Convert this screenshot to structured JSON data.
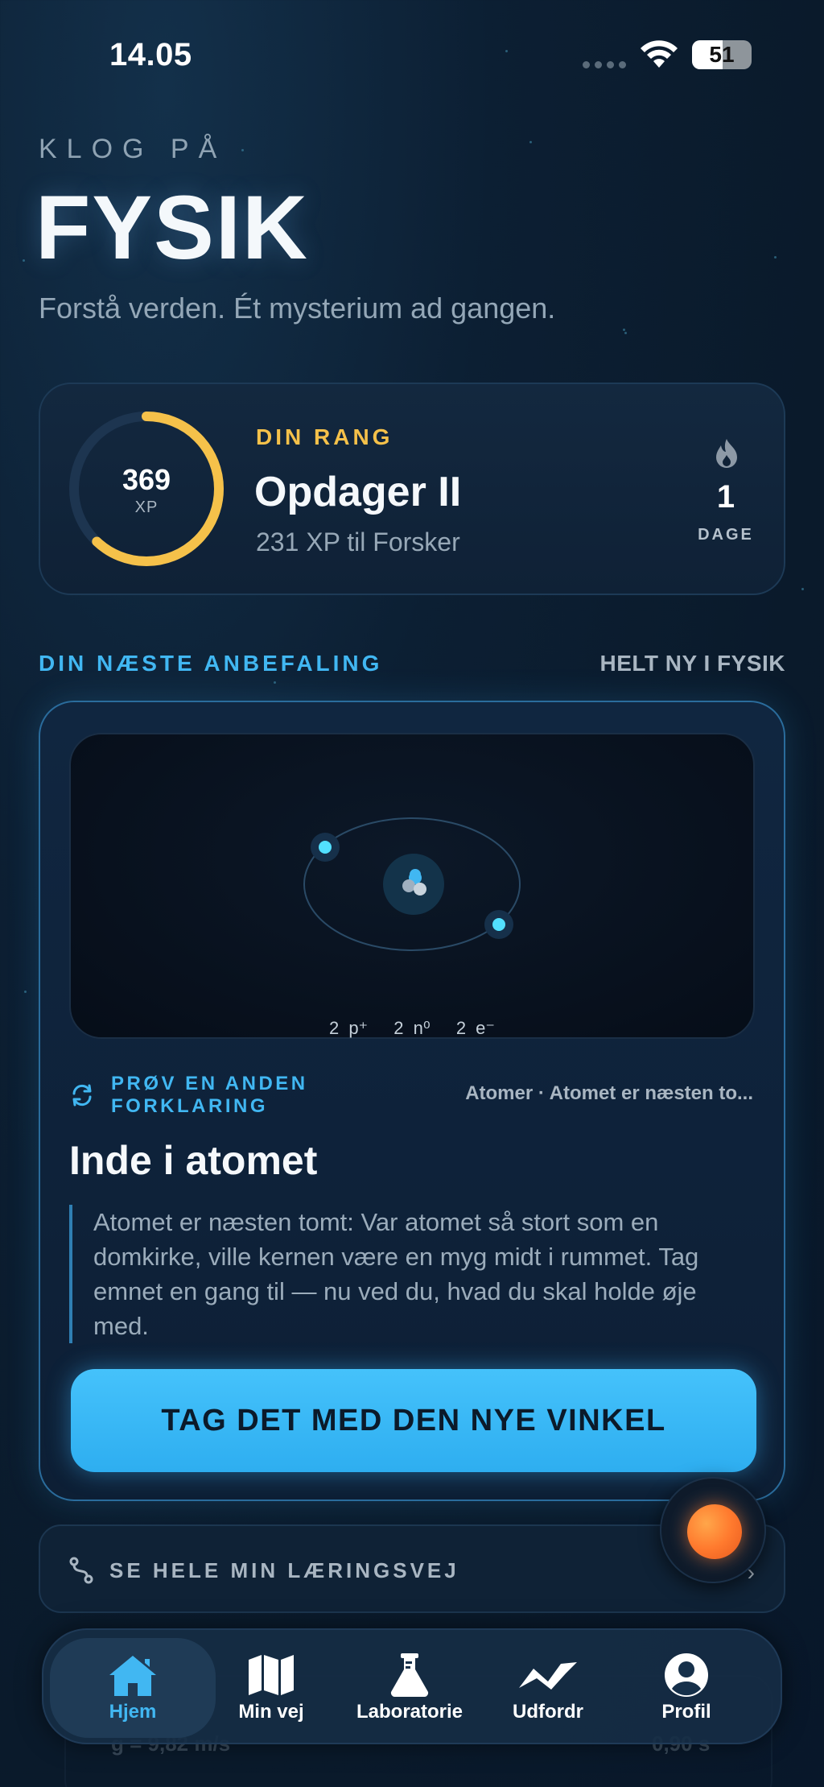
{
  "status_bar": {
    "time": "14.05",
    "battery": "51"
  },
  "hero": {
    "eyebrow": "KLOG PÅ",
    "title": "FYSIK",
    "subtitle": "Forstå verden. Ét mysterium ad gangen."
  },
  "rank_card": {
    "xp_value": "369",
    "xp_unit": "XP",
    "xp_progress_fraction": 0.62,
    "label": "DIN RANG",
    "rank_name": "Opdager II",
    "next_rank": "231 XP til Forsker",
    "streak_value": "1",
    "streak_unit": "DAGE"
  },
  "recommendation": {
    "section_title": "DIN NÆSTE ANBEFALING",
    "section_tag": "HELT NY I FYSIK",
    "atom_stats": [
      "2 p⁺",
      "2 n⁰",
      "2 e⁻"
    ],
    "alt_label": "PRØV EN ANDEN FORKLARING",
    "breadcrumb": "Atomer · Atomet er næsten to...",
    "title": "Inde i atomet",
    "quote": "Atomet er næsten tomt: Var atomet så stort som en domkirke, ville kernen være en myg midt i rummet. Tag emnet en gang til — nu ved du, hvad du skal holde øje med.",
    "cta": "TAG DET MED DEN NYE VINKEL"
  },
  "learning_path": {
    "label": "SE HELE MIN LÆRINGSVEJ"
  },
  "background_card": {
    "left": "g = 9,82 m/s",
    "right": "0,90 s"
  },
  "tabbar": {
    "items": [
      {
        "label": "Hjem",
        "icon": "home-icon",
        "active": true
      },
      {
        "label": "Min vej",
        "icon": "map-icon",
        "active": false
      },
      {
        "label": "Laboratorie",
        "icon": "flask-icon",
        "active": false
      },
      {
        "label": "Udfordr",
        "icon": "challenge-wave-icon",
        "active": false
      },
      {
        "label": "Profil",
        "icon": "profile-icon",
        "active": false
      }
    ]
  },
  "colors": {
    "accent": "#41b7f2",
    "gold": "#f5c14a",
    "background": "#0c1f33",
    "orb": "#ff7a2e"
  }
}
